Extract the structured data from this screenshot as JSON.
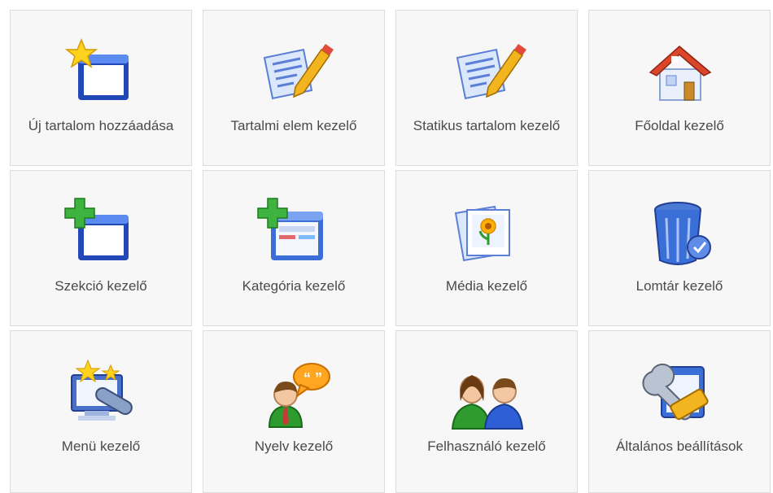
{
  "tiles": [
    {
      "label": "Új tartalom hozzáadása",
      "icon": "new-content-icon"
    },
    {
      "label": "Tartalmi elem kezelő",
      "icon": "content-item-edit-icon"
    },
    {
      "label": "Statikus tartalom kezelő",
      "icon": "static-content-edit-icon"
    },
    {
      "label": "Főoldal kezelő",
      "icon": "home-icon"
    },
    {
      "label": "Szekció kezelő",
      "icon": "section-add-icon"
    },
    {
      "label": "Kategória kezelő",
      "icon": "category-add-icon"
    },
    {
      "label": "Média kezelő",
      "icon": "media-pictures-icon"
    },
    {
      "label": "Lomtár kezelő",
      "icon": "trash-bin-icon"
    },
    {
      "label": "Menü kezelő",
      "icon": "menu-screen-icon"
    },
    {
      "label": "Nyelv kezelő",
      "icon": "language-speech-icon"
    },
    {
      "label": "Felhasználó kezelő",
      "icon": "users-icon"
    },
    {
      "label": "Általános beállítások",
      "icon": "settings-tools-icon"
    }
  ],
  "colors": {
    "tile_bg": "#f7f7f7",
    "tile_border": "#dcdcdc",
    "label_text": "#4a4a4a",
    "icon_blue": "#2e5fcf",
    "icon_green": "#3fb33f",
    "star_yellow": "#ffd21f",
    "roof_red": "#d9462b"
  }
}
